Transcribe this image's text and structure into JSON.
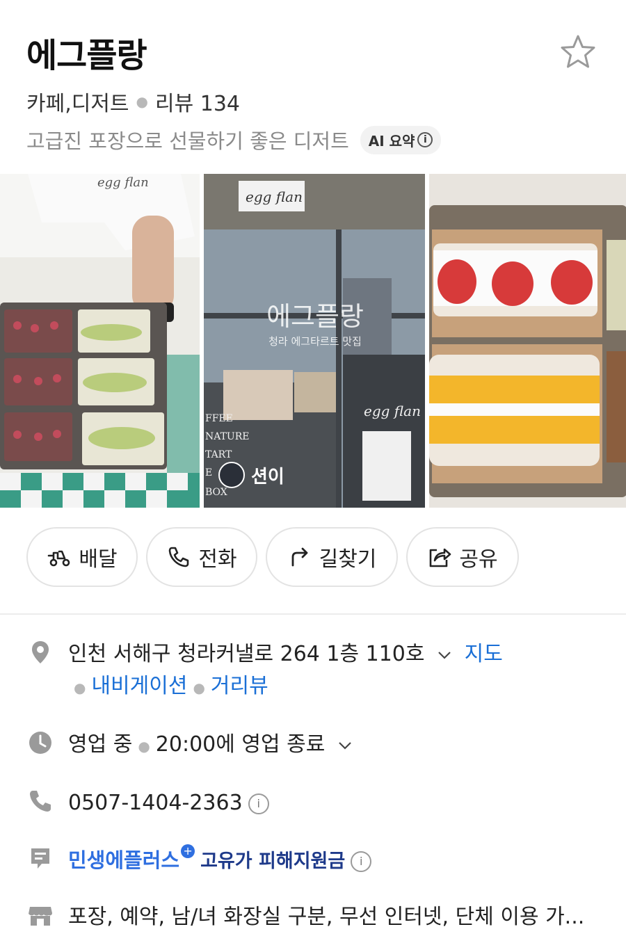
{
  "place": {
    "name": "에그플랑",
    "category": "카페,디저트",
    "review_label": "리뷰 134",
    "summary": "고급진 포장으로 선물하기 좋은 디저트",
    "ai_badge": "AI 요약"
  },
  "photos": {
    "p1_tshirt_text": "egg flan",
    "p2_overlay_title": "에그플랑",
    "p2_overlay_subtitle": "청라 에그타르트 맛집",
    "p2_sign": "egg flan",
    "p2_window_sign": "egg flan",
    "p2_window_left": [
      "FFEE",
      "NATURE",
      "TART",
      "E",
      "BOX"
    ],
    "p2_user": "션이"
  },
  "actions": [
    {
      "label": "배달",
      "icon": "scooter-icon"
    },
    {
      "label": "전화",
      "icon": "phone-icon"
    },
    {
      "label": "길찾기",
      "icon": "directions-icon"
    },
    {
      "label": "공유",
      "icon": "share-icon"
    }
  ],
  "info": {
    "address": "인천 서해구 청라커낼로 264 1층 110호",
    "map_link": "지도",
    "navigation_link": "내비게이션",
    "street_view_link": "거리뷰",
    "hours_status": "영업 중",
    "hours_detail": "20:00에 영업 종료",
    "phone": "0507-1404-2363",
    "promo_brand": "민생에플러스",
    "promo_text": "고유가 피해지원금",
    "amenities": "포장, 예약, 남/녀 화장실 구분, 무선 인터넷, 단체 이용 가..."
  },
  "colors": {
    "link": "#1a6fd6",
    "promo_blue": "#2f6fe0",
    "muted": "#8a8a8a",
    "icon_gray": "#9a9a9a"
  }
}
